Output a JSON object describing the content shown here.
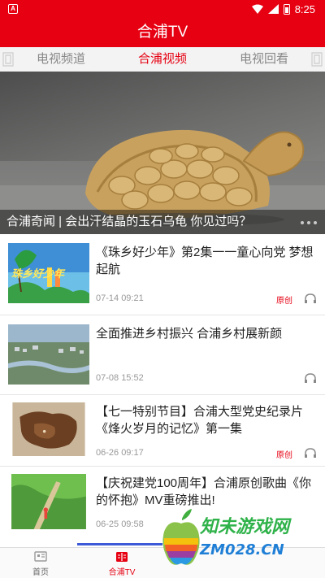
{
  "status_bar": {
    "left_icon": "A",
    "time": "8:25"
  },
  "header": {
    "title": "合浦TV"
  },
  "tabs": [
    {
      "label": "电视频道"
    },
    {
      "label": "合浦视频"
    },
    {
      "label": "电视回看"
    }
  ],
  "banner": {
    "caption": "合浦奇闻 | 会出汗结晶的玉石乌龟 你见过吗？"
  },
  "news": [
    {
      "title": "《珠乡好少年》第2集一一童心向党 梦想起航",
      "date": "07-14 09:21",
      "source": "原创",
      "thumb_text": "珠乡好少年"
    },
    {
      "title": "全面推进乡村振兴 合浦乡村展新颜",
      "date": "07-08 15:52",
      "source": ""
    },
    {
      "title": "【七一特别节目】合浦大型党史纪录片《烽火岁月的记忆》第一集",
      "date": "06-26 09:17",
      "source": "原创"
    },
    {
      "title": "【庆祝建党100周年】合浦原创歌曲《你的怀抱》MV重磅推出!",
      "date": "06-25 09:58",
      "source": ""
    }
  ],
  "bottom_tabs": [
    {
      "label": "首页"
    },
    {
      "label": "合浦TV"
    }
  ],
  "watermark": {
    "line1": "知未游戏网",
    "line2": "ZM028.CN"
  },
  "colors": {
    "brand_red": "#e60012",
    "tab_indicator": "#3c5ad8"
  }
}
